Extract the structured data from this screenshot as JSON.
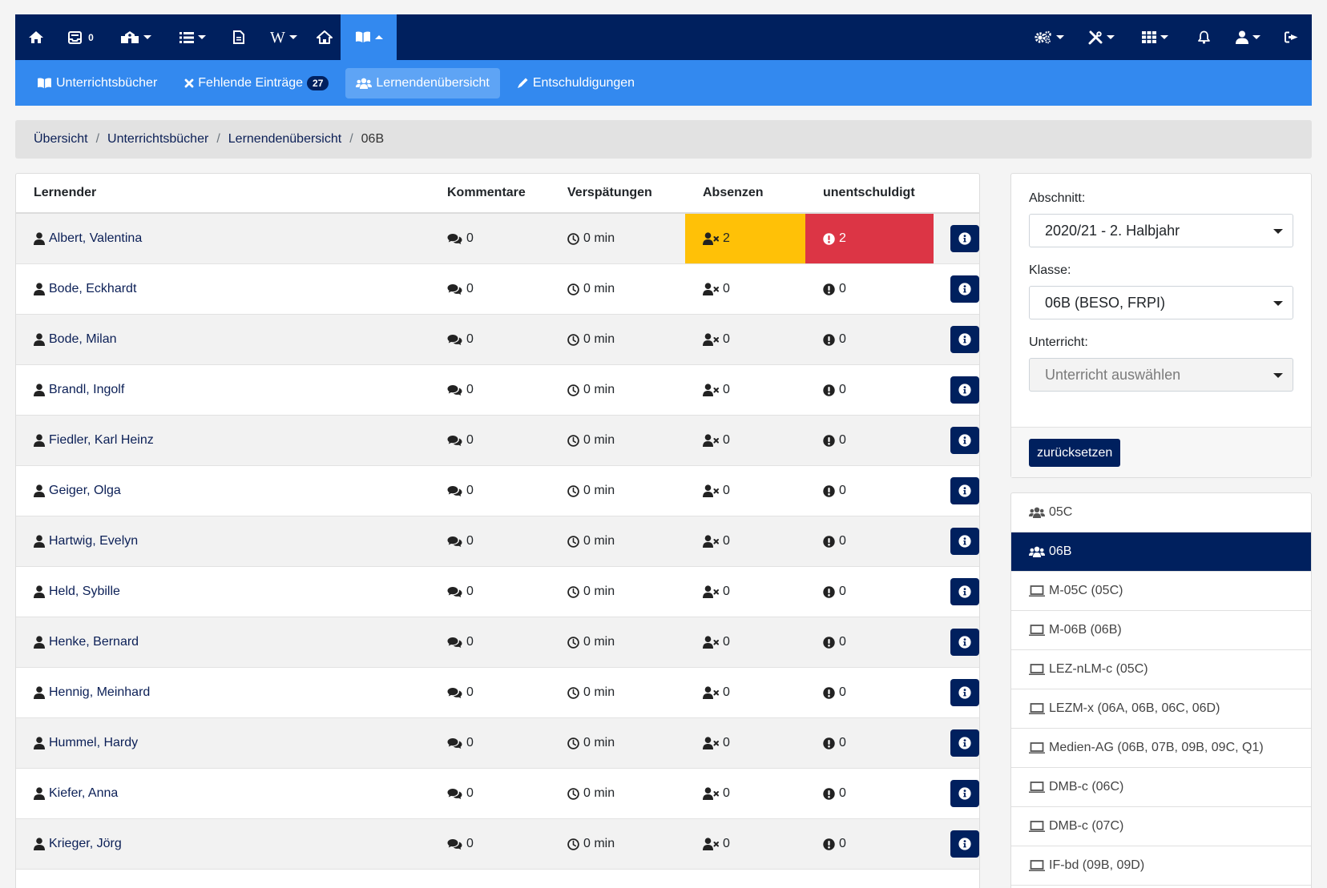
{
  "topnav": {
    "messages_count": "0",
    "icons": {
      "home": "home-icon",
      "messages": "inbox-icon",
      "school": "school-icon",
      "list": "list-icon",
      "document": "document-icon",
      "wiki": "W",
      "house": "house-icon",
      "book": "book-open-icon",
      "settings": "cogs-icon",
      "tools": "tools-icon",
      "apps": "grid-icon",
      "notifications": "bell-icon",
      "user": "user-icon",
      "logout": "sign-out-icon"
    }
  },
  "subnav": {
    "items": [
      {
        "label": "Unterrichtsbücher",
        "icon": "book-open-icon"
      },
      {
        "label": "Fehlende Einträge",
        "icon": "times-icon",
        "badge": "27"
      },
      {
        "label": "Lernendenübersicht",
        "icon": "users-icon",
        "active": true
      },
      {
        "label": "Entschuldigungen",
        "icon": "pencil-icon"
      }
    ]
  },
  "breadcrumb": {
    "items": [
      "Übersicht",
      "Unterrichtsbücher",
      "Lernendenübersicht"
    ],
    "current": "06B"
  },
  "table": {
    "headers": {
      "name": "Lernender",
      "comments": "Kommentare",
      "late": "Verspätungen",
      "absences": "Absenzen",
      "unexcused": "unentschuldigt"
    },
    "rows": [
      {
        "name": "Albert, Valentina",
        "comments": "0",
        "late": "0 min",
        "absences": "2",
        "unexcused": "2"
      },
      {
        "name": "Bode, Eckhardt",
        "comments": "0",
        "late": "0 min",
        "absences": "0",
        "unexcused": "0"
      },
      {
        "name": "Bode, Milan",
        "comments": "0",
        "late": "0 min",
        "absences": "0",
        "unexcused": "0"
      },
      {
        "name": "Brandl, Ingolf",
        "comments": "0",
        "late": "0 min",
        "absences": "0",
        "unexcused": "0"
      },
      {
        "name": "Fiedler, Karl Heinz",
        "comments": "0",
        "late": "0 min",
        "absences": "0",
        "unexcused": "0"
      },
      {
        "name": "Geiger, Olga",
        "comments": "0",
        "late": "0 min",
        "absences": "0",
        "unexcused": "0"
      },
      {
        "name": "Hartwig, Evelyn",
        "comments": "0",
        "late": "0 min",
        "absences": "0",
        "unexcused": "0"
      },
      {
        "name": "Held, Sybille",
        "comments": "0",
        "late": "0 min",
        "absences": "0",
        "unexcused": "0"
      },
      {
        "name": "Henke, Bernard",
        "comments": "0",
        "late": "0 min",
        "absences": "0",
        "unexcused": "0"
      },
      {
        "name": "Hennig, Meinhard",
        "comments": "0",
        "late": "0 min",
        "absences": "0",
        "unexcused": "0"
      },
      {
        "name": "Hummel, Hardy",
        "comments": "0",
        "late": "0 min",
        "absences": "0",
        "unexcused": "0"
      },
      {
        "name": "Kiefer, Anna",
        "comments": "0",
        "late": "0 min",
        "absences": "0",
        "unexcused": "0"
      },
      {
        "name": "Krieger, Jörg",
        "comments": "0",
        "late": "0 min",
        "absences": "0",
        "unexcused": "0"
      }
    ]
  },
  "filters": {
    "section_label": "Abschnitt:",
    "section_value": "2020/21 - 2. Halbjahr",
    "class_label": "Klasse:",
    "class_value": "06B (BESO, FRPI)",
    "lesson_label": "Unterricht:",
    "lesson_placeholder": "Unterricht auswählen",
    "reset_label": "zurücksetzen"
  },
  "groups": [
    {
      "label": "05C",
      "icon": "users-icon"
    },
    {
      "label": "06B",
      "icon": "users-icon",
      "active": true
    },
    {
      "label": "M-05C (05C)",
      "icon": "laptop-icon"
    },
    {
      "label": "M-06B (06B)",
      "icon": "laptop-icon"
    },
    {
      "label": "LEZ-nLM-c (05C)",
      "icon": "laptop-icon"
    },
    {
      "label": "LEZM-x (06A, 06B, 06C, 06D)",
      "icon": "laptop-icon"
    },
    {
      "label": "Medien-AG (06B, 07B, 09B, 09C, Q1)",
      "icon": "laptop-icon"
    },
    {
      "label": "DMB-c (06C)",
      "icon": "laptop-icon"
    },
    {
      "label": "DMB-c (07C)",
      "icon": "laptop-icon"
    },
    {
      "label": "IF-bd (09B, 09D)",
      "icon": "laptop-icon"
    }
  ],
  "colors": {
    "navy": "#00205e",
    "blue": "#3389ef",
    "warning": "#ffc107",
    "danger": "#dc3545"
  }
}
